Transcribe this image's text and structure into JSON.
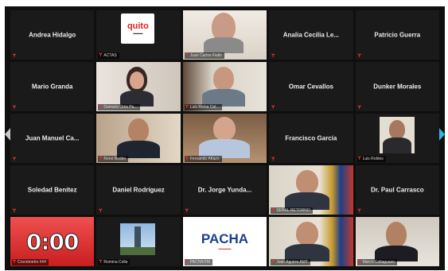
{
  "navigation": {
    "prev_icon": "chevron-left-icon",
    "next_icon": "chevron-right-icon"
  },
  "colors": {
    "speaker_outline": "#9ad24a",
    "muted_mic": "#ee3333",
    "next_arrow": "#33b6e6"
  },
  "tiles": [
    {
      "name": "Andrea Hidalgo"
    },
    {
      "name": "ACTAS",
      "logo_text": "quito"
    },
    {
      "name": "Juan Carlos Fiallo"
    },
    {
      "name": "Analia Cecilia Le..."
    },
    {
      "name": "Patricio Guerra"
    },
    {
      "name": "Mario Granda"
    },
    {
      "name": "Damaris Ortiz Pa..."
    },
    {
      "name": "Luis Reina Cel..."
    },
    {
      "name": "Omar Cevallos"
    },
    {
      "name": "Dunker Morales"
    },
    {
      "name": "Juan Manuel Ca..."
    },
    {
      "name": "René Bedón"
    },
    {
      "name": "Fernando Añazo"
    },
    {
      "name": "Francisco García"
    },
    {
      "name": "Luis Robles"
    },
    {
      "name": "Soledad Benítez"
    },
    {
      "name": "Daniel Rodríguez"
    },
    {
      "name": "Dr. Jorge Yunda..."
    },
    {
      "name": "SEÑAL RETORNO"
    },
    {
      "name": "Dr. Paul Carrasco"
    },
    {
      "name": "Cronómetro ###",
      "timer": "0:00"
    },
    {
      "name": "Romina Colla"
    },
    {
      "name": "PACHA FM",
      "logo_text": "PACHA"
    },
    {
      "name": "Juan Aguirre AMT"
    },
    {
      "name": "Marco Collaguazo"
    }
  ]
}
